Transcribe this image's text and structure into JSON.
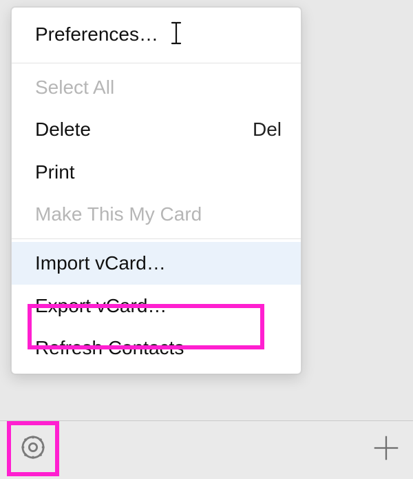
{
  "menu": {
    "preferences": {
      "label": "Preferences…"
    },
    "select_all": {
      "label": "Select All"
    },
    "delete": {
      "label": "Delete",
      "shortcut": "Del"
    },
    "print": {
      "label": "Print"
    },
    "make_card": {
      "label": "Make This My Card"
    },
    "import_vcard": {
      "label": "Import vCard…"
    },
    "export_vcard": {
      "label": "Export vCard…"
    },
    "refresh": {
      "label": "Refresh Contacts"
    }
  },
  "toolbar": {
    "settings_icon": "gear-icon",
    "add_icon": "plus-icon"
  },
  "highlight_color": "#ff1fd0"
}
